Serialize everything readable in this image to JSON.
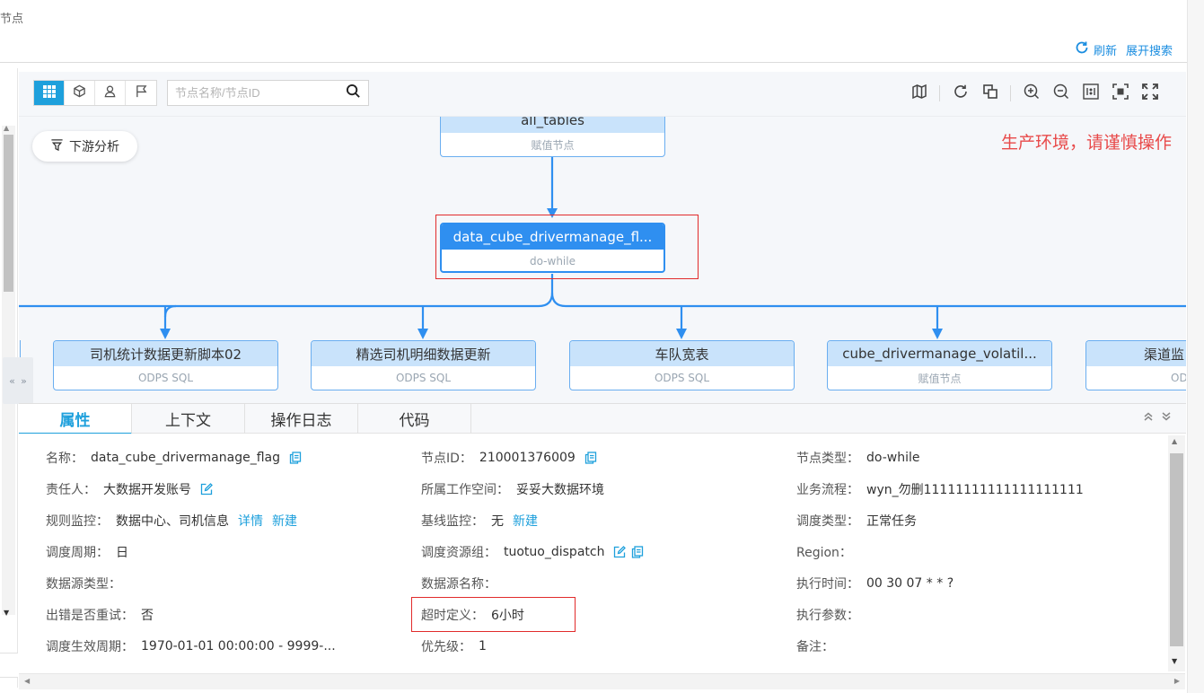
{
  "page": {
    "top_title": "节点",
    "refresh_label": "刷新",
    "expand_search_label": "展开搜索"
  },
  "toolbar": {
    "search_placeholder": "节点名称/节点ID",
    "view_buttons": [
      "grid-icon",
      "cube-icon",
      "user-icon",
      "flag-icon"
    ],
    "right_tools": [
      "map-icon",
      "refresh-icon",
      "layers-icon",
      "zoom-in-icon",
      "zoom-out-icon",
      "one-to-one-icon",
      "fit-screen-icon",
      "fullscreen-icon"
    ]
  },
  "canvas": {
    "downstream_label": "下游分析",
    "env_warning": "生产环境，请谨慎操作",
    "parent_node": {
      "title": "all_tables",
      "subtitle": "赋值节点"
    },
    "current_node": {
      "title": "data_cube_drivermanage_fl...",
      "subtitle": "do-while"
    },
    "child_nodes": [
      {
        "title": "司机统计数据更新脚本02",
        "subtitle": "ODPS SQL"
      },
      {
        "title": "精选司机明细数据更新",
        "subtitle": "ODPS SQL"
      },
      {
        "title": "车队宽表",
        "subtitle": "ODPS SQL"
      },
      {
        "title": "cube_drivermanage_volatil...",
        "subtitle": "赋值节点"
      },
      {
        "title": "渠道监",
        "subtitle": "OD"
      }
    ],
    "colors": {
      "edge": "#2f8ff0",
      "active_node": "#2f8ff0",
      "node_header": "#c9e3fb",
      "highlight": "#e12b2b"
    }
  },
  "tabs": [
    "属性",
    "上下文",
    "操作日志",
    "代码"
  ],
  "active_tab": "属性",
  "properties": {
    "name_label": "名称：",
    "name_value": "data_cube_drivermanage_flag",
    "node_id_label": "节点ID：",
    "node_id_value": "210001376009",
    "node_type_label": "节点类型：",
    "node_type_value": "do-while",
    "owner_label": "责任人：",
    "owner_value": "大数据开发账号",
    "workspace_label": "所属工作空间：",
    "workspace_value": "妥妥大数据环境",
    "flow_label": "业务流程：",
    "flow_value": "wyn_勿删11111111111111111111",
    "rule_label": "规则监控：",
    "rule_value": "数据中心、司机信息",
    "rule_detail": "详情",
    "rule_new": "新建",
    "baseline_label": "基线监控：",
    "baseline_value": "无",
    "baseline_new": "新建",
    "sched_type_label": "调度类型：",
    "sched_type_value": "正常任务",
    "period_label": "调度周期：",
    "period_value": "日",
    "res_group_label": "调度资源组：",
    "res_group_value": "tuotuo_dispatch",
    "region_label": "Region：",
    "region_value": "",
    "ds_type_label": "数据源类型：",
    "ds_type_value": "",
    "ds_name_label": "数据源名称：",
    "ds_name_value": "",
    "exec_time_label": "执行时间：",
    "exec_time_value": "00 30 07 * * ?",
    "retry_label": "出错是否重试：",
    "retry_value": "否",
    "timeout_label": "超时定义：",
    "timeout_value": "6小时",
    "exec_params_label": "执行参数：",
    "exec_params_value": "",
    "effective_label": "调度生效周期：",
    "effective_value": "1970-01-01 00:00:00 - 9999-...",
    "priority_label": "优先级：",
    "priority_value": "1",
    "remark_label": "备注：",
    "remark_value": ""
  }
}
